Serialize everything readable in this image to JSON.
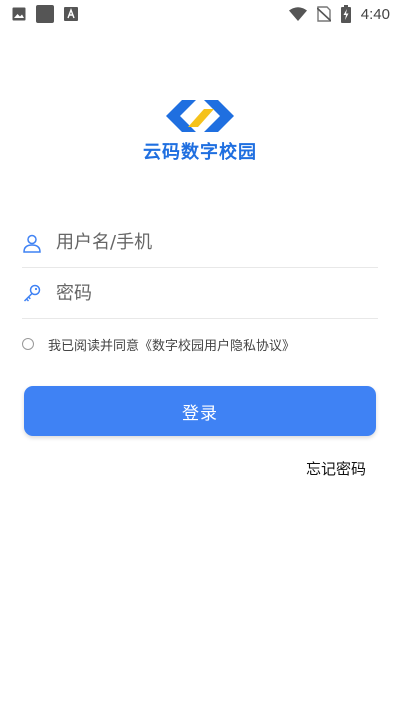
{
  "status_bar": {
    "time": "4:40",
    "left_icons": [
      "image-icon",
      "square-icon",
      "font-icon"
    ],
    "right_icons": [
      "wifi-icon",
      "no-sim-icon",
      "battery-charging-icon"
    ]
  },
  "app": {
    "logo_text": "云码数字校园",
    "brand_blue": "#1f6fe0",
    "brand_yellow": "#f5c21b"
  },
  "form": {
    "username_placeholder": "用户名/手机",
    "password_placeholder": "密码",
    "username_value": "",
    "password_value": ""
  },
  "agreement": {
    "checked": false,
    "text": "我已阅读并同意《数字校园用户隐私协议》"
  },
  "actions": {
    "login_label": "登录",
    "forgot_password_label": "忘记密码",
    "primary_color": "#3f82f4"
  }
}
